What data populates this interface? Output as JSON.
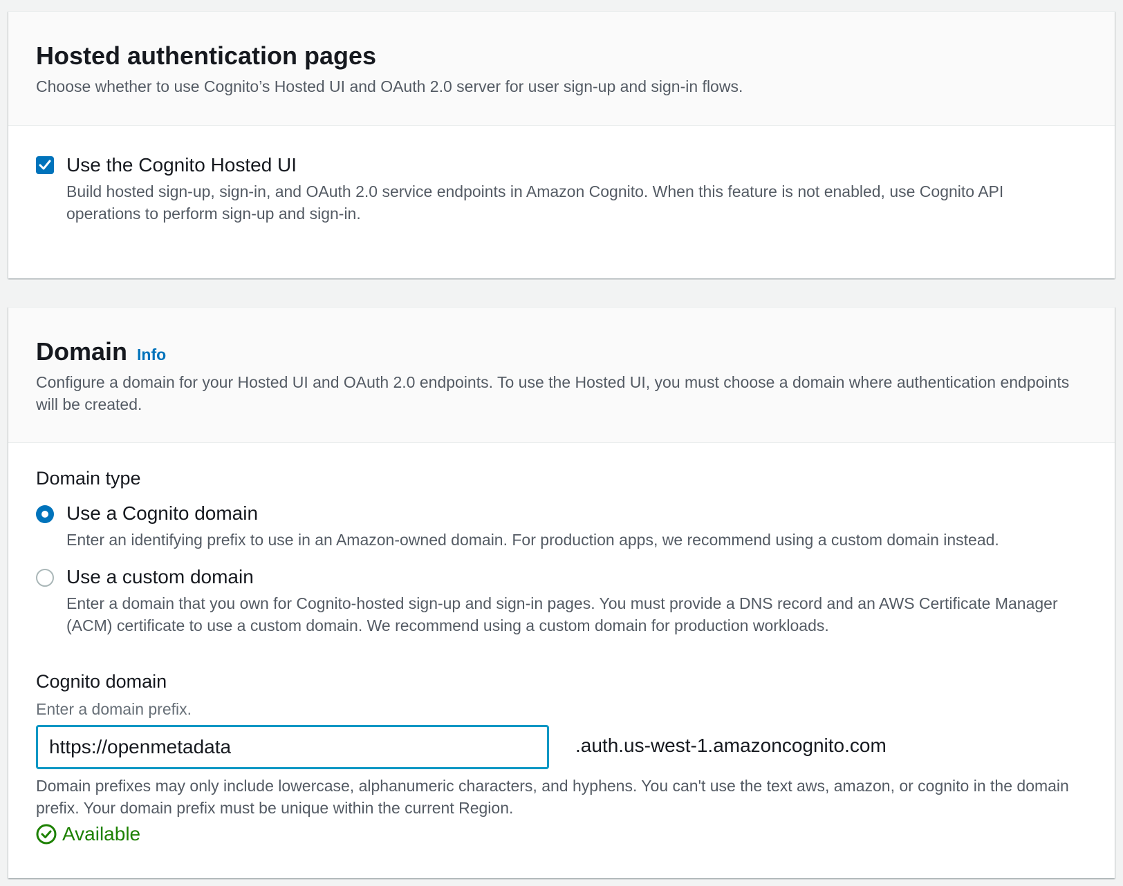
{
  "hosted": {
    "title": "Hosted authentication pages",
    "description": "Choose whether to use Cognito’s Hosted UI and OAuth 2.0 server for user sign-up and sign-in flows.",
    "option_label": "Use the Cognito Hosted UI",
    "option_description": "Build hosted sign-up, sign-in, and OAuth 2.0 service endpoints in Amazon Cognito. When this feature is not enabled, use Cognito API operations to perform sign-up and sign-in.",
    "checked": true
  },
  "domain": {
    "title": "Domain",
    "info_link": "Info",
    "description": "Configure a domain for your Hosted UI and OAuth 2.0 endpoints. To use the Hosted UI, you must choose a domain where authentication endpoints will be created.",
    "type_label": "Domain type",
    "options": [
      {
        "label": "Use a Cognito domain",
        "description": "Enter an identifying prefix to use in an Amazon-owned domain. For production apps, we recommend using a custom domain instead.",
        "selected": true
      },
      {
        "label": "Use a custom domain",
        "description": "Enter a domain that you own for Cognito-hosted sign-up and sign-in pages. You must provide a DNS record and an AWS Certificate Manager (ACM) certificate to use a custom domain. We recommend using a custom domain for production workloads.",
        "selected": false
      }
    ],
    "field_label": "Cognito domain",
    "field_hint": "Enter a domain prefix.",
    "input_value": "https://openmetadata",
    "suffix": ".auth.us-west-1.amazoncognito.com",
    "constraint": "Domain prefixes may only include lowercase, alphanumeric characters, and hyphens. You can't use the text aws, amazon, or cognito in the domain prefix. Your domain prefix must be unique within the current Region.",
    "status_text": "Available",
    "status_icon": "check-circle-icon"
  },
  "colors": {
    "accent": "#0073bb",
    "input_focus": "#0a97c4",
    "success": "#1d8102",
    "background": "#f2f3f3"
  }
}
